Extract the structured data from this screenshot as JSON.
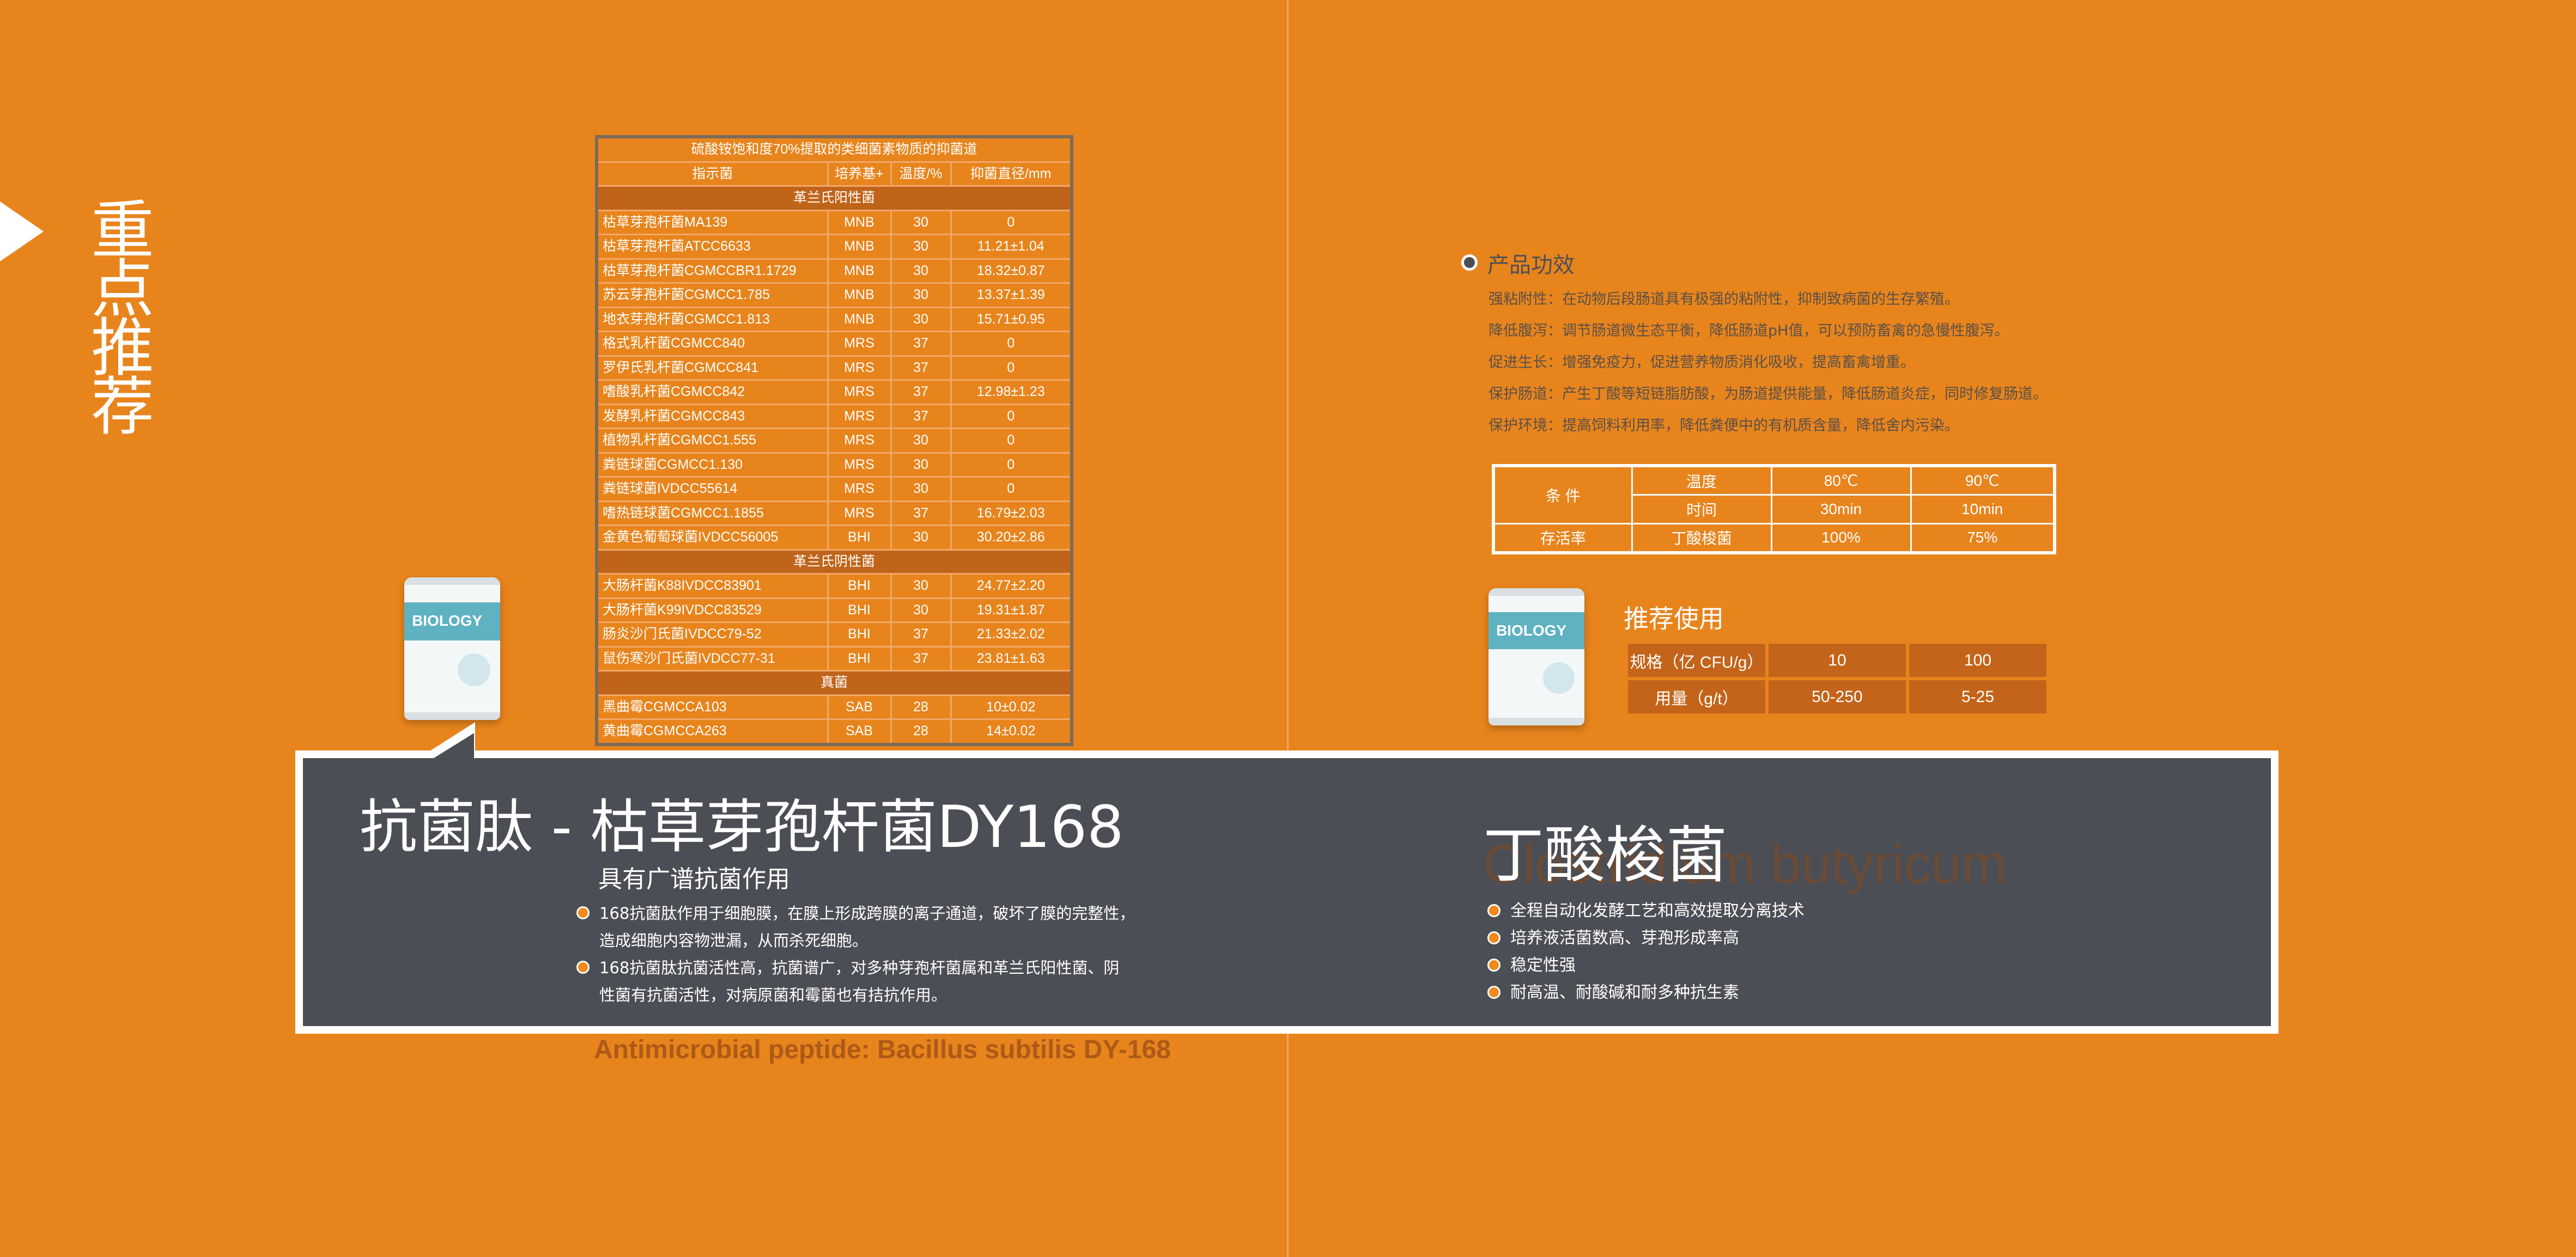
{
  "side_title": [
    "重",
    "点",
    "推",
    "荐"
  ],
  "antibacterial_table": {
    "caption": "硫酸铵饱和度70%提取的类细菌素物质的抑菌道",
    "headers": [
      "指示菌",
      "培养基+",
      "温度/%",
      "抑菌直径/mm"
    ],
    "sections": [
      {
        "title": "革兰氏阳性菌",
        "rows": [
          [
            "枯草芽孢杆菌MA139",
            "MNB",
            "30",
            "0"
          ],
          [
            "枯草芽孢杆菌ATCC6633",
            "MNB",
            "30",
            "11.21±1.04"
          ],
          [
            "枯草芽孢杆菌CGMCCBR1.1729",
            "MNB",
            "30",
            "18.32±0.87"
          ],
          [
            "苏云芽孢杆菌CGMCC1.785",
            "MNB",
            "30",
            "13.37±1.39"
          ],
          [
            "地衣芽孢杆菌CGMCC1.813",
            "MNB",
            "30",
            "15.71±0.95"
          ],
          [
            "格式乳杆菌CGMCC840",
            "MRS",
            "37",
            "0"
          ],
          [
            "罗伊氏乳杆菌CGMCC841",
            "MRS",
            "37",
            "0"
          ],
          [
            "嗜酸乳杆菌CGMCC842",
            "MRS",
            "37",
            "12.98±1.23"
          ],
          [
            "发酵乳杆菌CGMCC843",
            "MRS",
            "37",
            "0"
          ],
          [
            "植物乳杆菌CGMCC1.555",
            "MRS",
            "30",
            "0"
          ],
          [
            "粪链球菌CGMCC1.130",
            "MRS",
            "30",
            "0"
          ],
          [
            "粪链球菌IVDCC55614",
            "MRS",
            "30",
            "0"
          ],
          [
            "嗜热链球菌CGMCC1.1855",
            "MRS",
            "37",
            "16.79±2.03"
          ],
          [
            "金黄色葡萄球菌IVDCC56005",
            "BHI",
            "30",
            "30.20±2.86"
          ]
        ]
      },
      {
        "title": "革兰氏阴性菌",
        "rows": [
          [
            "大肠杆菌K88IVDCC83901",
            "BHI",
            "30",
            "24.77±2.20"
          ],
          [
            "大肠杆菌K99IVDCC83529",
            "BHI",
            "30",
            "19.31±1.87"
          ],
          [
            "肠炎沙门氏菌IVDCC79-52",
            "BHI",
            "37",
            "21.33±2.02"
          ],
          [
            "鼠伤寒沙门氏菌IVDCC77-31",
            "BHI",
            "37",
            "23.81±1.63"
          ]
        ]
      },
      {
        "title": "真菌",
        "rows": [
          [
            "黑曲霉CGMCCA103",
            "SAB",
            "28",
            "10±0.02"
          ],
          [
            "黄曲霉CGMCCA263",
            "SAB",
            "28",
            "14±0.02"
          ]
        ]
      }
    ]
  },
  "product_bag_label": "BIOLOGY",
  "efficacy": {
    "title": "产品功效",
    "items": [
      "强粘附性：在动物后段肠道具有极强的粘附性，抑制致病菌的生存繁殖。",
      "降低腹泻：调节肠道微生态平衡，降低肠道pH值，可以预防畜禽的急慢性腹泻。",
      "促进生长：增强免疫力，促进营养物质消化吸收，提高畜禽增重。",
      "保护肠道：产生丁酸等短链脂肪酸，为肠道提供能量，降低肠道炎症，同时修复肠道。",
      "保护环境：提高饲料利用率，降低粪便中的有机质含量，降低舍内污染。"
    ]
  },
  "condition_table": {
    "condition_label": "条 件",
    "temp_label": "温度",
    "temp_values": [
      "80℃",
      "90℃"
    ],
    "time_label": "时间",
    "time_values": [
      "30min",
      "10min"
    ],
    "survival_label": "存活率",
    "bacteria_label": "丁酸梭菌",
    "survival_values": [
      "100%",
      "75%"
    ]
  },
  "recommended_use": {
    "title": "推荐使用",
    "rows": [
      [
        "规格（亿 CFU/g）",
        "10",
        "100"
      ],
      [
        "用量（g/t）",
        "50-250",
        "5-25"
      ]
    ]
  },
  "peptide": {
    "title": "抗菌肽 - 枯草芽孢杆菌DY168",
    "subtitle": "具有广谱抗菌作用",
    "points": [
      [
        "168抗菌肽作用于细胞膜，在膜上形成跨膜的离子通道，破坏了膜的完整性，",
        "造成细胞内容物泄漏，从而杀死细胞。"
      ],
      [
        "168抗菌肽抗菌活性高，抗菌谱广，对多种芽孢杆菌属和革兰氏阳性菌、阴",
        "性菌有抗菌活性，对病原菌和霉菌也有拮抗作用。"
      ]
    ],
    "english": "Antimicrobial peptide: Bacillus subtilis DY-168"
  },
  "butyricum": {
    "title": "丁酸梭菌",
    "english": "Clostridium butyricum",
    "points": [
      "全程自动化发酵工艺和高效提取分离技术",
      "培养液活菌数高、芽孢形成率高",
      "稳定性强",
      "耐高温、耐酸碱和耐多种抗生素"
    ]
  },
  "colors": {
    "background": "#e8841c",
    "banner": "#4c4e55",
    "section_row": "#c0641a",
    "bag_band": "#5fb2c2"
  }
}
